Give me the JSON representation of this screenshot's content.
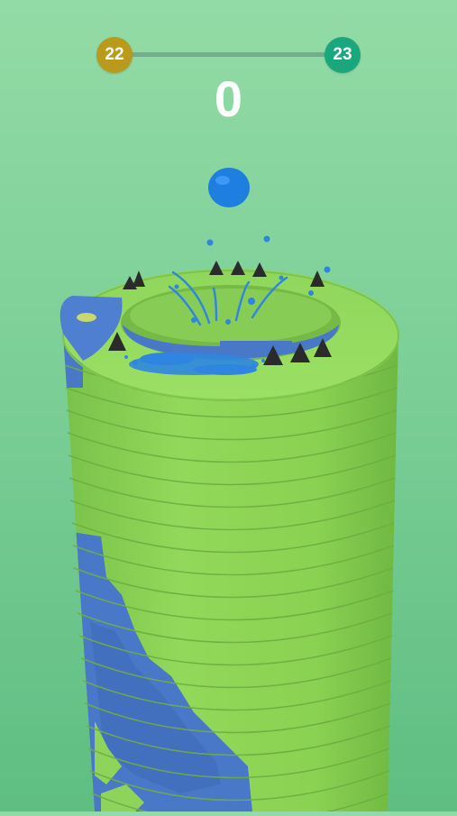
{
  "hud": {
    "current_level": "22",
    "next_level": "23",
    "score": "0"
  },
  "colors": {
    "current_level_badge": "#b99a1a",
    "next_level_badge": "#1aa77e",
    "tower_green": "#8fd45a",
    "tower_blue": "#4a78c9",
    "ball_blue": "#1e7fe0",
    "spike_black": "#2b2b2b"
  },
  "icons": {
    "ball": "ball-icon",
    "spikes": "spike-icon"
  }
}
